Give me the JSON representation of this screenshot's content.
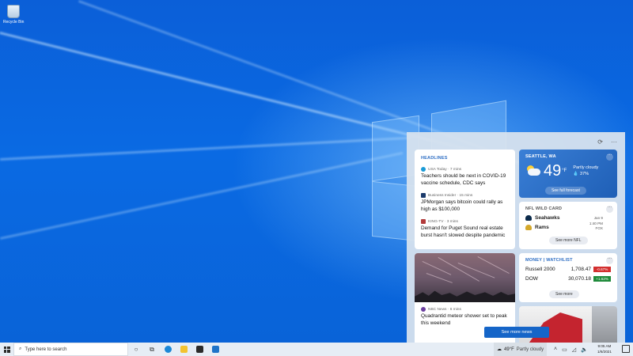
{
  "desktop": {
    "recycle_bin_label": "Recycle Bin"
  },
  "panel": {
    "refresh_icon": "refresh-icon",
    "more_label": "···",
    "headlines": {
      "label": "HEADLINES",
      "items": [
        {
          "source": "USA Today · 7 mins",
          "title": "Teachers should be next in COVID-19 vaccine schedule, CDC says",
          "icon_color": "#1a9bd7"
        },
        {
          "source": "Business Insider · 15 mins",
          "title": "JPMorgan says bitcoin could rally as high as $100,000",
          "icon_color": "#1b3a6b"
        },
        {
          "source": "KING-TV · 3 mins",
          "title": "Demand for Puget Sound real estate burst hasn't slowed despite pandemic",
          "icon_color": "#b23b3b"
        }
      ]
    },
    "weather": {
      "location": "SEATTLE, WA",
      "temp": "49",
      "unit": "°F",
      "condition": "Partly cloudy",
      "precip": "37%",
      "forecast_button": "See full forecast"
    },
    "nfl": {
      "label": "NFL WILD CARD",
      "team1": "Seahawks",
      "team2": "Rams",
      "date": "Jan 9",
      "time": "1:40 PM",
      "network": "FOX",
      "button": "See more NFL"
    },
    "photo_news": {
      "source": "NBC News · 6 mins",
      "title": "Quadrantid meteor shower set to peak this weekend"
    },
    "stocks": {
      "label": "MONEY | WATCHLIST",
      "rows": [
        {
          "name": "Russell 2000",
          "value": "1,708.47",
          "change": "-0.67%",
          "color": "#d32f2f"
        },
        {
          "name": "DOW",
          "value": "30,070.18",
          "change": "+1.62%",
          "color": "#1e8a3a"
        }
      ],
      "button": "See more"
    },
    "see_more_news": "See more news"
  },
  "taskbar": {
    "search_placeholder": "Type here to search",
    "weather_temp": "49°F",
    "weather_condition": "Partly cloudy",
    "time": "9:05 AM",
    "date": "1/6/2021"
  }
}
